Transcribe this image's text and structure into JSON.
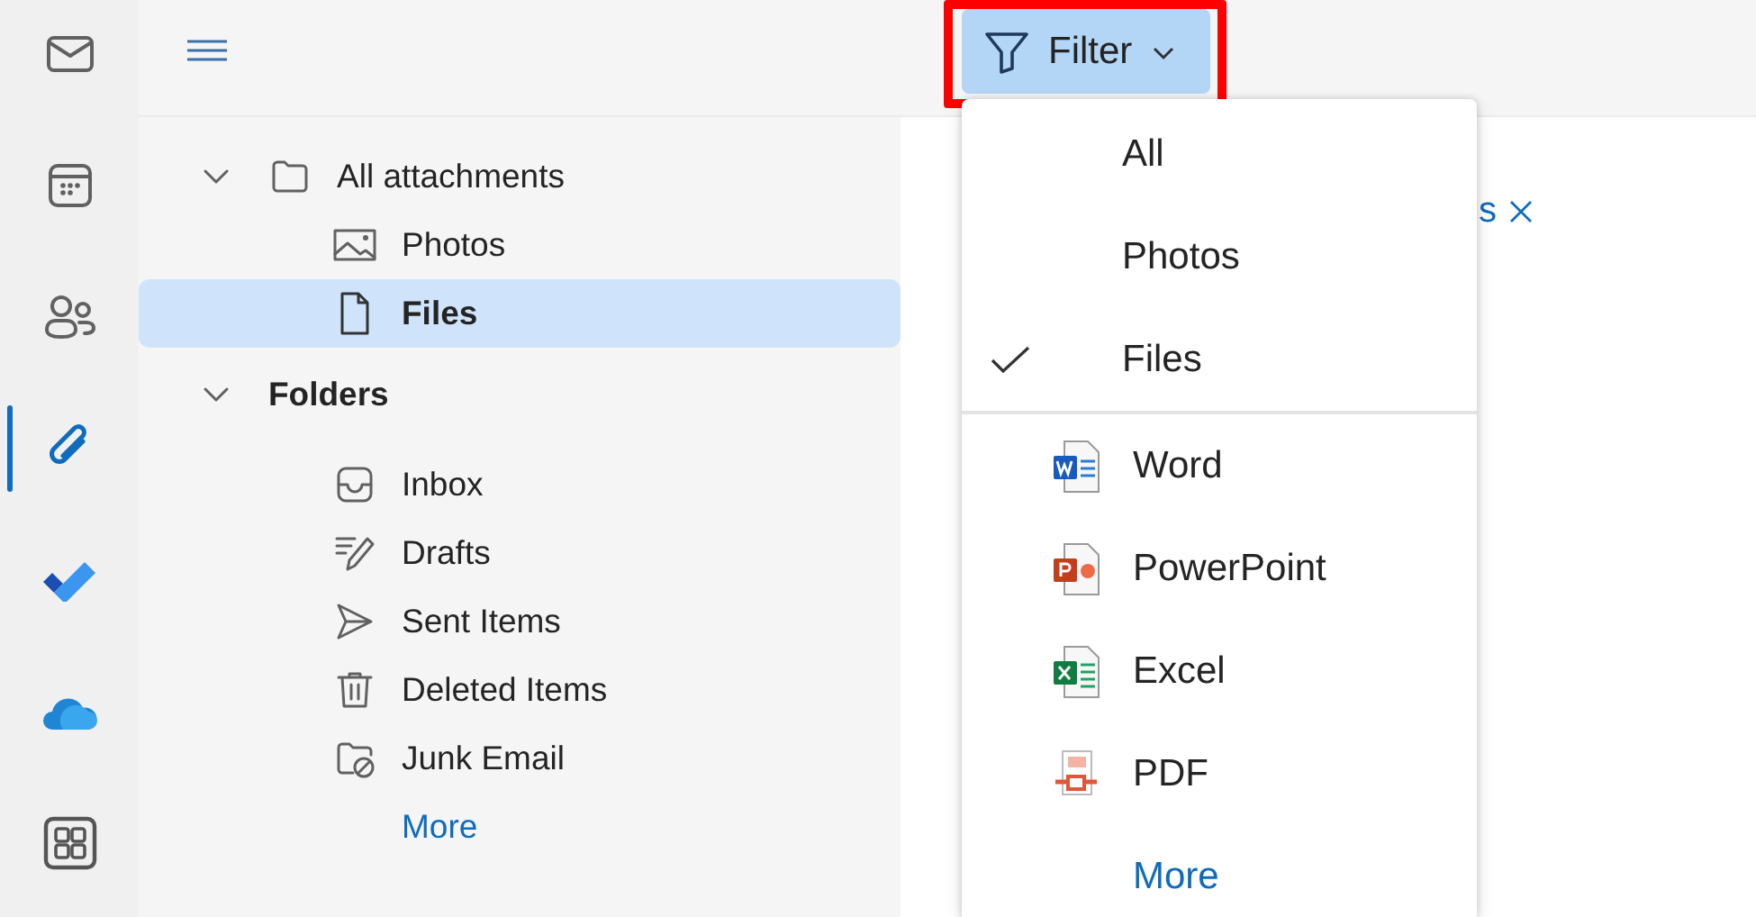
{
  "rail": [
    {
      "kind": "mail",
      "selected": false
    },
    {
      "kind": "calendar",
      "selected": false
    },
    {
      "kind": "people",
      "selected": false
    },
    {
      "kind": "attachment",
      "selected": true
    },
    {
      "kind": "todo",
      "selected": false
    },
    {
      "kind": "cloud",
      "selected": false
    },
    {
      "kind": "apps",
      "selected": false
    }
  ],
  "filter_button": {
    "label": "Filter",
    "highlighted": true
  },
  "folder_tree": [
    {
      "label": "All attachments",
      "kind": "folder",
      "expanded": true,
      "selected": false,
      "children": [
        {
          "label": "Photos",
          "kind": "photo",
          "selected": false
        },
        {
          "label": "Files",
          "kind": "file",
          "selected": true
        }
      ]
    },
    {
      "label": "Folders",
      "kind": "section",
      "expanded": true,
      "selected": false,
      "children": [
        {
          "label": "Inbox",
          "kind": "inbox",
          "selected": false
        },
        {
          "label": "Drafts",
          "kind": "drafts",
          "selected": false
        },
        {
          "label": "Sent Items",
          "kind": "sent",
          "selected": false
        },
        {
          "label": "Deleted Items",
          "kind": "trash",
          "selected": false
        },
        {
          "label": "Junk Email",
          "kind": "junk",
          "selected": false
        }
      ]
    }
  ],
  "folder_more": "More",
  "content": {
    "chip_fragment": "s"
  },
  "filter_menu": {
    "options": [
      {
        "label": "All",
        "checked": false
      },
      {
        "label": "Photos",
        "checked": false
      },
      {
        "label": "Files",
        "checked": true
      }
    ],
    "file_types": [
      {
        "label": "Word",
        "kind": "word"
      },
      {
        "label": "PowerPoint",
        "kind": "powerpoint"
      },
      {
        "label": "Excel",
        "kind": "excel"
      },
      {
        "label": "PDF",
        "kind": "pdf"
      }
    ],
    "more": "More"
  }
}
